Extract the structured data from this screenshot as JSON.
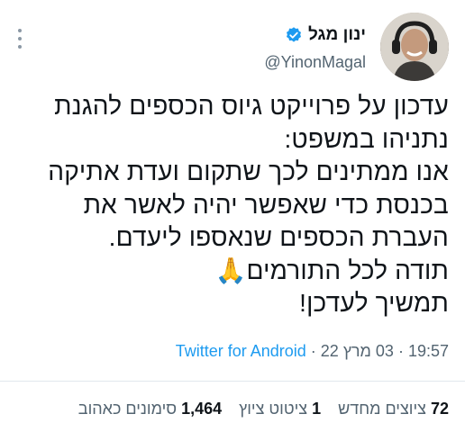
{
  "tweet": {
    "author": {
      "display_name": "ינון מגל",
      "handle": "@YinonMagal",
      "verified": true,
      "verified_color": "#1d9bf0"
    },
    "text": "עדכון על פרוייקט גיוס הכספים להגנת\nנתניהו במשפט:\nאנו ממתינים לכך שתקום ועדת אתיקה\nבכנסת כדי שאפשר יהיה לאשר את\nהעברת הכספים שנאספו ליעדם.\nתודה לכל התורמים🙏\nתמשיך לעדכן!",
    "time": "19:57",
    "date": "03 מרץ 22",
    "separator": "·",
    "source": "Twitter for Android",
    "stats": {
      "retweets_count": "72",
      "retweets_label": "ציוצים מחדש",
      "quotes_count": "1",
      "quotes_label": "ציטוט ציוץ",
      "likes_count": "1,464",
      "likes_label": "סימונים כאהוב"
    }
  }
}
